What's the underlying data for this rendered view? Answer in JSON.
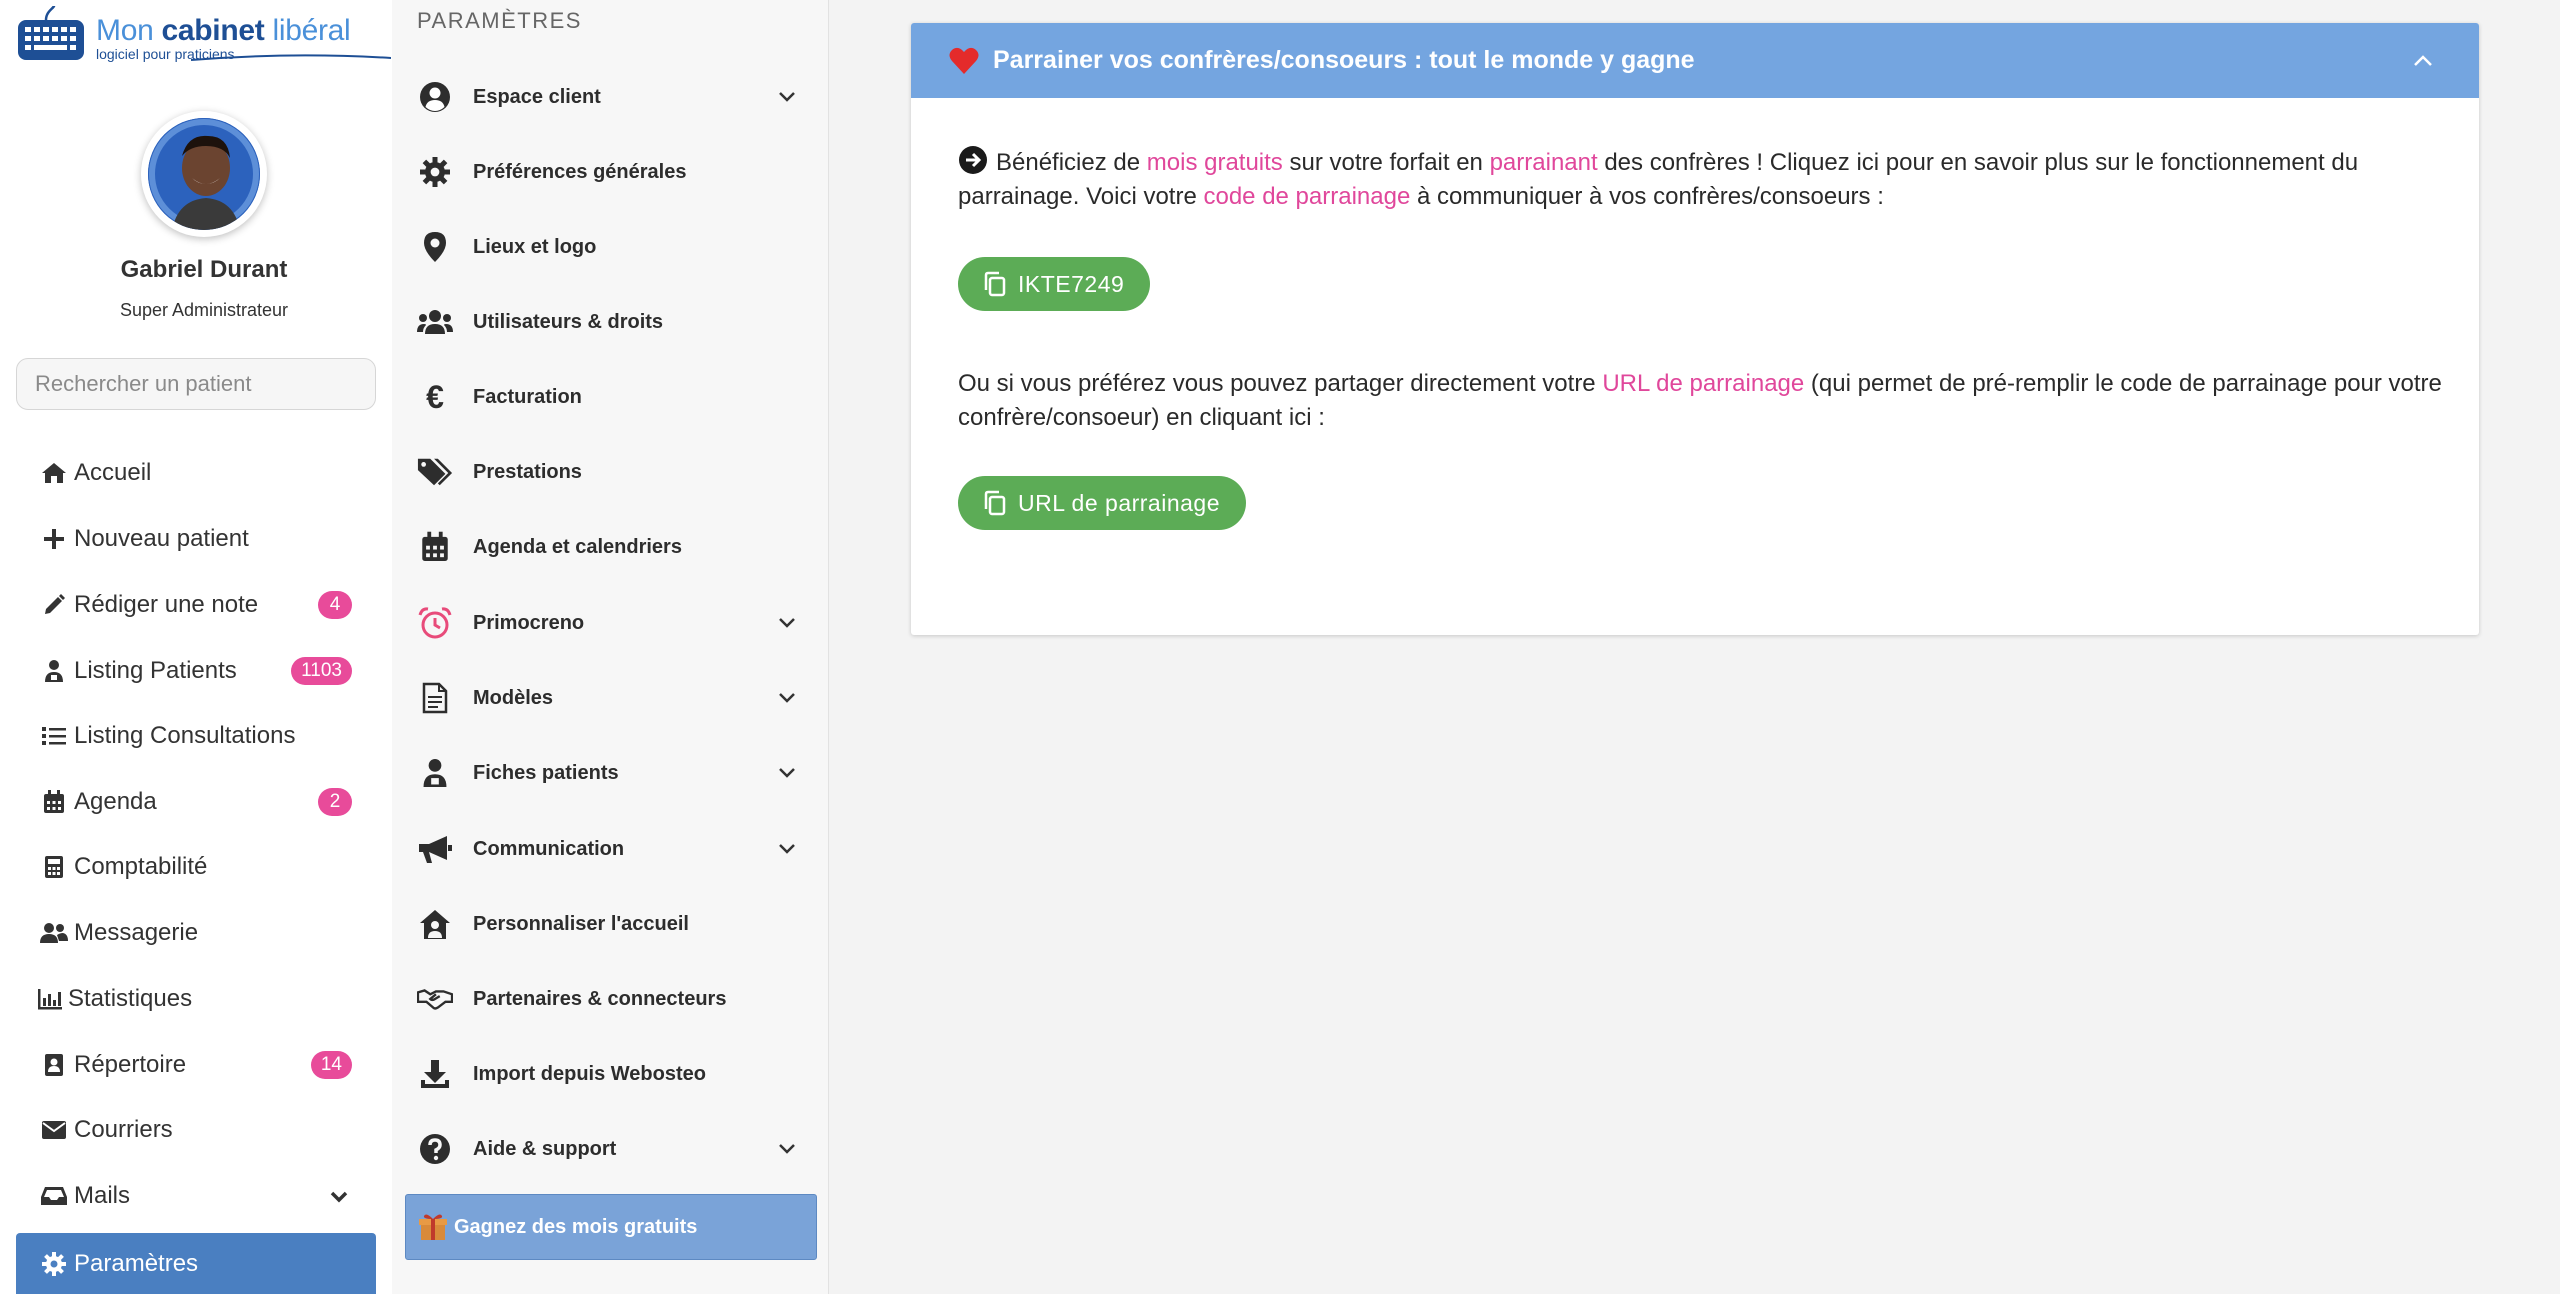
{
  "app": {
    "logo_title_1": "Mon ",
    "logo_title_2": "cabinet",
    "logo_title_3": " libéral",
    "logo_subtitle": "logiciel pour praticiens"
  },
  "user": {
    "name": "Gabriel Durant",
    "role": "Super Administrateur"
  },
  "search": {
    "placeholder": "Rechercher un patient"
  },
  "nav": [
    {
      "label": "Accueil",
      "icon": "home-icon"
    },
    {
      "label": "Nouveau patient",
      "icon": "plus-icon"
    },
    {
      "label": "Rédiger une note",
      "icon": "pencil-icon",
      "badge": "4"
    },
    {
      "label": "Listing Patients",
      "icon": "patient-icon",
      "badge": "1103"
    },
    {
      "label": "Listing Consultations",
      "icon": "list-icon"
    },
    {
      "label": "Agenda",
      "icon": "calendar-icon",
      "badge": "2"
    },
    {
      "label": "Comptabilité",
      "icon": "calculator-icon"
    },
    {
      "label": "Messagerie",
      "icon": "users-icon"
    },
    {
      "label": "Statistiques",
      "icon": "chart-icon"
    },
    {
      "label": "Répertoire",
      "icon": "address-book-icon",
      "badge": "14"
    },
    {
      "label": "Courriers",
      "icon": "envelope-icon"
    },
    {
      "label": "Mails",
      "icon": "inbox-icon"
    },
    {
      "label": "Paramètres",
      "icon": "gear-icon"
    }
  ],
  "settings": {
    "title": "PARAMÈTRES",
    "items": [
      {
        "label": "Espace client",
        "icon": "user-circle-icon"
      },
      {
        "label": "Préférences générales",
        "icon": "gear-icon"
      },
      {
        "label": "Lieux et logo",
        "icon": "map-pin-icon"
      },
      {
        "label": "Utilisateurs & droits",
        "icon": "users-icon"
      },
      {
        "label": "Facturation",
        "icon": "euro-icon"
      },
      {
        "label": "Prestations",
        "icon": "tags-icon"
      },
      {
        "label": "Agenda et calendriers",
        "icon": "calendar-icon"
      },
      {
        "label": "Primocreno",
        "icon": "alarm-clock-icon"
      },
      {
        "label": "Modèles",
        "icon": "document-icon"
      },
      {
        "label": "Fiches patients",
        "icon": "patient-icon"
      },
      {
        "label": "Communication",
        "icon": "megaphone-icon"
      },
      {
        "label": "Personnaliser l'accueil",
        "icon": "house-user-icon"
      },
      {
        "label": "Partenaires & connecteurs",
        "icon": "handshake-icon"
      },
      {
        "label": "Import depuis Webosteo",
        "icon": "download-icon"
      },
      {
        "label": "Aide & support",
        "icon": "question-circle-icon"
      }
    ],
    "gift_button": "Gagnez des mois gratuits"
  },
  "card": {
    "title": "Parrainer vos confrères/consoeurs : tout le monde y gagne",
    "p1_a": "Bénéficiez de ",
    "p1_link1": "mois gratuits",
    "p1_b": " sur votre forfait en ",
    "p1_link2": "parrainant",
    "p1_c": " des confrères ! Cliquez ici pour en savoir plus sur le fonctionnement du parrainage. Voici votre ",
    "p1_link3": "code de parrainage",
    "p1_d": " à communiquer à vos confrères/consoeurs :",
    "code_button": "IKTE7249",
    "p2_a": "Ou si vous préférez vous pouvez partager directement votre ",
    "p2_link": "URL de parrainage",
    "p2_b": " (qui permet de pré-remplir le code de parrainage pour votre confrère/consoeur) en cliquant ici :",
    "url_button": "URL de parrainage"
  },
  "colors": {
    "accent_blue": "#74a5e0",
    "active_nav": "#4a7fc1",
    "badge_pink": "#e84b9a",
    "link_pink": "#e0479b",
    "green_button": "#5cac56"
  }
}
